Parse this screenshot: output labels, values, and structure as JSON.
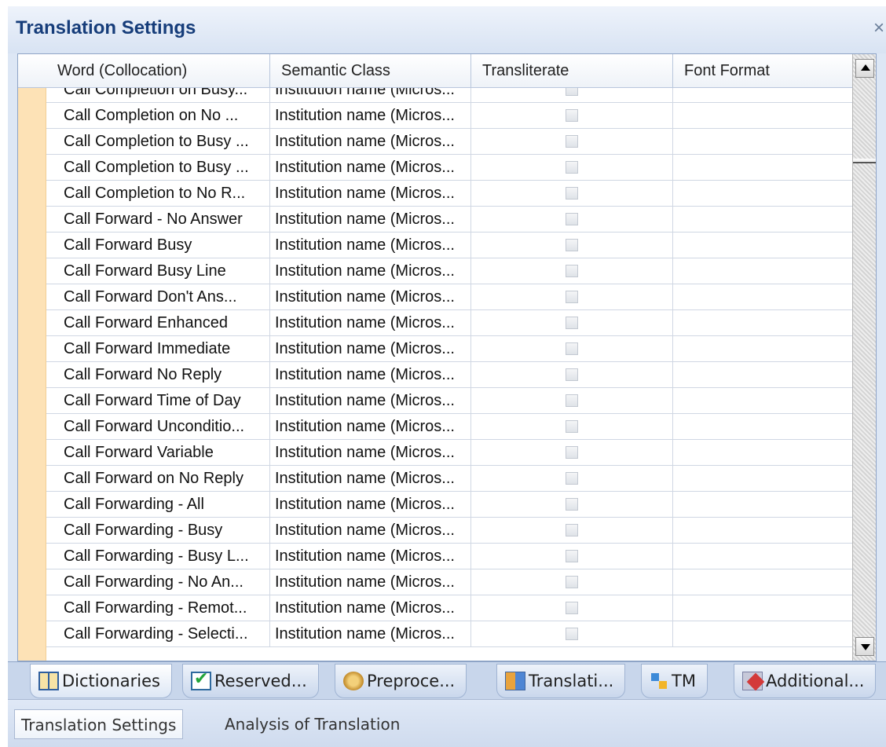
{
  "panel": {
    "title": "Translation Settings",
    "close_glyph": "×"
  },
  "grid": {
    "columns": [
      "Word (Collocation)",
      "Semantic Class",
      "Transliterate",
      "Font Format"
    ],
    "rows": [
      {
        "word": "Call Completion on Busy...",
        "semantic": "Institution name (Micros...",
        "transliterate": false,
        "font_format": ""
      },
      {
        "word": "Call Completion on No ...",
        "semantic": "Institution name (Micros...",
        "transliterate": false,
        "font_format": ""
      },
      {
        "word": "Call Completion to Busy ...",
        "semantic": "Institution name (Micros...",
        "transliterate": false,
        "font_format": ""
      },
      {
        "word": "Call Completion to Busy ...",
        "semantic": "Institution name (Micros...",
        "transliterate": false,
        "font_format": ""
      },
      {
        "word": "Call Completion to No R...",
        "semantic": "Institution name (Micros...",
        "transliterate": false,
        "font_format": ""
      },
      {
        "word": "Call Forward - No Answer",
        "semantic": "Institution name (Micros...",
        "transliterate": false,
        "font_format": ""
      },
      {
        "word": "Call Forward Busy",
        "semantic": "Institution name (Micros...",
        "transliterate": false,
        "font_format": ""
      },
      {
        "word": "Call Forward Busy Line",
        "semantic": "Institution name (Micros...",
        "transliterate": false,
        "font_format": ""
      },
      {
        "word": "Call Forward Don't Ans...",
        "semantic": "Institution name (Micros...",
        "transliterate": false,
        "font_format": ""
      },
      {
        "word": "Call Forward Enhanced",
        "semantic": "Institution name (Micros...",
        "transliterate": false,
        "font_format": ""
      },
      {
        "word": "Call Forward Immediate",
        "semantic": "Institution name (Micros...",
        "transliterate": false,
        "font_format": ""
      },
      {
        "word": "Call Forward No Reply",
        "semantic": "Institution name (Micros...",
        "transliterate": false,
        "font_format": ""
      },
      {
        "word": "Call Forward Time of Day",
        "semantic": "Institution name (Micros...",
        "transliterate": false,
        "font_format": ""
      },
      {
        "word": "Call Forward Unconditio...",
        "semantic": "Institution name (Micros...",
        "transliterate": false,
        "font_format": ""
      },
      {
        "word": "Call Forward Variable",
        "semantic": "Institution name (Micros...",
        "transliterate": false,
        "font_format": ""
      },
      {
        "word": "Call Forward on No Reply",
        "semantic": "Institution name (Micros...",
        "transliterate": false,
        "font_format": ""
      },
      {
        "word": "Call Forwarding - All",
        "semantic": "Institution name (Micros...",
        "transliterate": false,
        "font_format": ""
      },
      {
        "word": "Call Forwarding - Busy",
        "semantic": "Institution name (Micros...",
        "transliterate": false,
        "font_format": ""
      },
      {
        "word": "Call Forwarding - Busy L...",
        "semantic": "Institution name (Micros...",
        "transliterate": false,
        "font_format": ""
      },
      {
        "word": "Call Forwarding - No An...",
        "semantic": "Institution name (Micros...",
        "transliterate": false,
        "font_format": ""
      },
      {
        "word": "Call Forwarding - Remot...",
        "semantic": "Institution name (Micros...",
        "transliterate": false,
        "font_format": ""
      },
      {
        "word": "Call Forwarding - Selecti...",
        "semantic": "Institution name (Micros...",
        "transliterate": false,
        "font_format": ""
      }
    ]
  },
  "tool_tabs": [
    {
      "label": "Dictionaries",
      "icon": "dictionary-icon",
      "active": true
    },
    {
      "label": "Reserved...",
      "icon": "reserved-check-icon",
      "active": false
    },
    {
      "label": "Preproce...",
      "icon": "preprocessing-gear-icon",
      "active": false
    },
    {
      "label": "Translati...",
      "icon": "translation-icon",
      "active": false
    },
    {
      "label": "TM",
      "icon": "tm-icon",
      "active": false
    },
    {
      "label": "Additional...",
      "icon": "additional-tools-icon",
      "active": false
    }
  ],
  "bottom_tabs": [
    {
      "label": "Translation Settings",
      "active": true
    },
    {
      "label": "Analysis of Translation",
      "active": false
    }
  ],
  "colors": {
    "title_text": "#163d7a",
    "panel_bg": "#dde7f5",
    "row_header_strip": "#fde2b6",
    "grid_line": "#d0d7e3"
  }
}
